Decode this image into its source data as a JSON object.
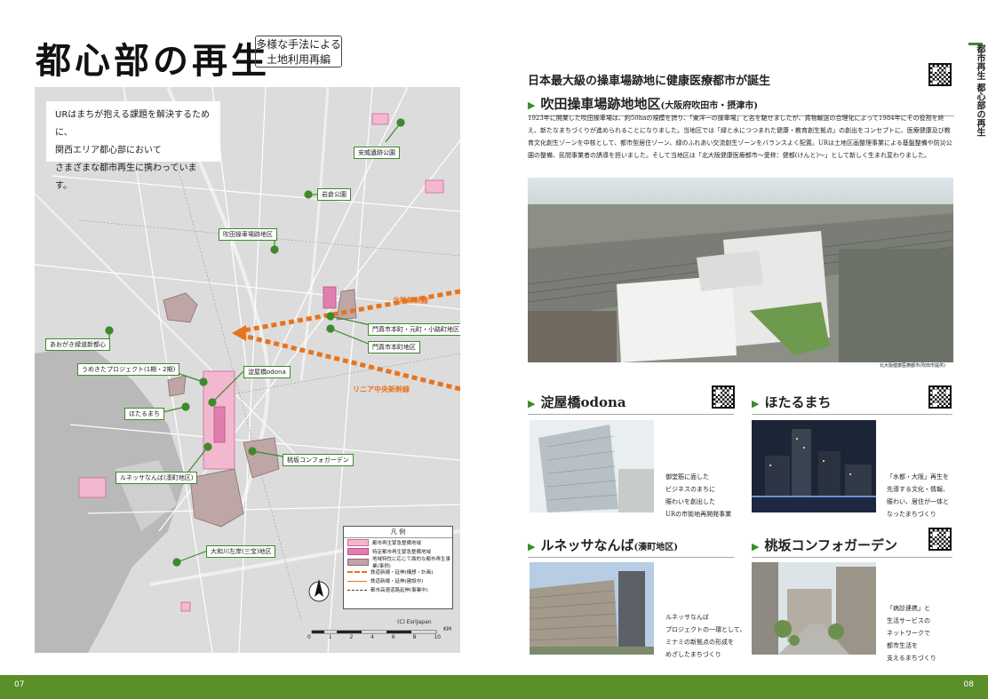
{
  "left_page": {
    "title": "都心部の再生",
    "subtitle_line1": "多様な手法による",
    "subtitle_line2": "土地利用再編",
    "intro_line1": "URはまちが抱える課題を解決するために、",
    "intro_line2": "関西エリア都心部において",
    "intro_line3": "さまざまな都市再生に携わっています。",
    "map_labels": [
      "安威遺跡公園",
      "岩倉公園",
      "吹田操車場跡地区",
      "門真市本町・元町・小路町地区",
      "門真市本町地区",
      "あおがき緑道新都心",
      "うめきたプロジェクト(1期・2期)",
      "淀屋橋odona",
      "ほたるまち",
      "桃坂コンフォガーデン",
      "ルネッサなんば(湊町地区)",
      "大和川左岸(三宝)地区"
    ],
    "shinkansen_north": "北陸新幹線",
    "shinkansen_linear": "リニア中央新幹線",
    "legend_title": "凡 例",
    "legend_items": [
      "都市再生緊急整備地域",
      "特定都市再生緊急整備地域",
      "地域特性に応じて面的な都市再生事業(事例)",
      "鉄道新線・延伸(構想・計画)",
      "鉄道新線・延伸(建設中)",
      "都市高速道路延伸(事業中)"
    ],
    "copyright": "(C) EsriJapan",
    "scale_ticks": [
      "0",
      "1",
      "2",
      "4",
      "6",
      "8",
      "10"
    ],
    "scale_unit": "KM",
    "page_number": "07"
  },
  "right_page": {
    "side_tab": "都市再生 都心部の再生",
    "headline": "日本最大級の操車場跡地に健康医療都市が誕生",
    "suita": {
      "title": "吹田操車場跡地地区",
      "location": "(大阪府吹田市・摂津市)",
      "body": "1923年に開業した吹田操車場は、約50haの規模を誇り、「東洋一の操車場」と名を馳せましたが、貨物輸送の合理化によって1984年にその役割を終え、新たなまちづくりが進められることになりました。当地区では「緑と水につつまれた健康・教育創生拠点」の創出をコンセプトに、医療健康及び教育文化創生ゾーンを中核として、都市型居住ゾーン、緑のふれあい交流創生ゾーンをバランスよく配置。URは土地区画整理事業による基盤整備や防災公園の整備、民間事業者の誘導を担いました。そして当地区は「北大阪健康医療都市～愛称：健都(けんと)～」として新しく生まれ変わりました。",
      "photo_credit": "北大阪健康医療都市(吹田市提供)"
    },
    "odona": {
      "title": "淀屋橋odona",
      "caption": [
        "御堂筋に面した",
        "ビジネスのまちに",
        "賑わいを創出した",
        "URの市街地再開発事業"
      ]
    },
    "hotaru": {
      "title": "ほたるまち",
      "caption": [
        "「水都・大阪」再生を",
        "先導する文化・情報、",
        "賑わい、居住が一体と",
        "なったまちづくり"
      ]
    },
    "renaissa": {
      "title": "ルネッサなんば",
      "location": "(湊町地区)",
      "caption": [
        "ルネッサなんば",
        "プロジェクトの一環として、",
        "ミナミの新拠点の形成を",
        "めざしたまちづくり"
      ]
    },
    "momosaka": {
      "title": "桃坂コンフォガーデン",
      "caption": [
        "「病診連携」と",
        "生活サービスの",
        "ネットワークで",
        "都市生活を",
        "支えるまちづくり"
      ]
    },
    "page_number": "08"
  },
  "colors": {
    "accent_green": "#3d8a2a",
    "footer_green": "#5b8f2a",
    "shinkansen_orange": "#e8731c",
    "area_pink": "#f2b8d0"
  }
}
